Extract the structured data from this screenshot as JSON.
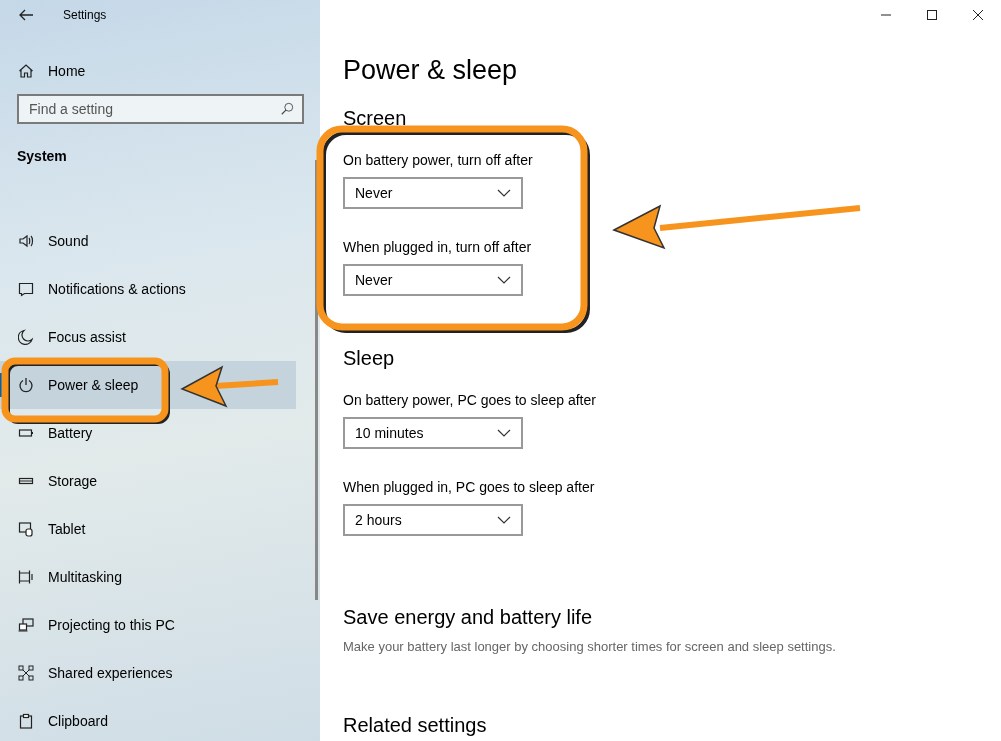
{
  "window": {
    "title": "Settings"
  },
  "sidebar": {
    "home": "Home",
    "search": {
      "placeholder": "Find a setting"
    },
    "section": "System",
    "items": [
      {
        "label": "Sound",
        "kind": "sound",
        "selected": false
      },
      {
        "label": "Notifications & actions",
        "kind": "notifications",
        "selected": false
      },
      {
        "label": "Focus assist",
        "kind": "focus",
        "selected": false
      },
      {
        "label": "Power & sleep",
        "kind": "power",
        "selected": true
      },
      {
        "label": "Battery",
        "kind": "battery",
        "selected": false
      },
      {
        "label": "Storage",
        "kind": "storage",
        "selected": false
      },
      {
        "label": "Tablet",
        "kind": "tablet",
        "selected": false
      },
      {
        "label": "Multitasking",
        "kind": "multitasking",
        "selected": false
      },
      {
        "label": "Projecting to this PC",
        "kind": "projecting",
        "selected": false
      },
      {
        "label": "Shared experiences",
        "kind": "shared",
        "selected": false
      },
      {
        "label": "Clipboard",
        "kind": "clipboard",
        "selected": false
      }
    ]
  },
  "main": {
    "title": "Power & sleep",
    "sections": [
      {
        "heading": "Screen",
        "settings": [
          {
            "label": "On battery power, turn off after",
            "value": "Never"
          },
          {
            "label": "When plugged in, turn off after",
            "value": "Never"
          }
        ]
      },
      {
        "heading": "Sleep",
        "settings": [
          {
            "label": "On battery power, PC goes to sleep after",
            "value": "10 minutes"
          },
          {
            "label": "When plugged in, PC goes to sleep after",
            "value": "2 hours"
          }
        ]
      },
      {
        "heading": "Save energy and battery life",
        "description": "Make your battery last longer by choosing shorter times for screen and sleep settings."
      },
      {
        "heading": "Related settings"
      }
    ]
  }
}
